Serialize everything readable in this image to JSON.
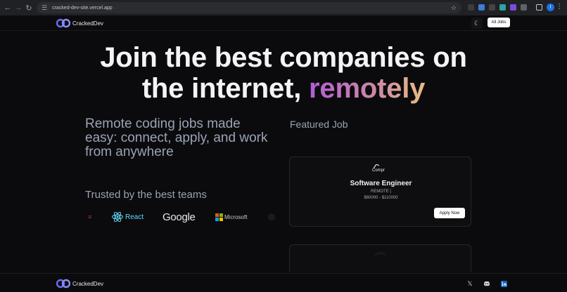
{
  "browser": {
    "url": "cracked-dev-site.vercel.app",
    "profile_initial": "I"
  },
  "header": {
    "brand": "CrackedDev",
    "all_jobs_label": "All Jobs"
  },
  "hero": {
    "line1": "Join the best companies on",
    "line2_prefix": "the internet, ",
    "line2_highlight": "remotely"
  },
  "tagline": "Remote coding jobs made easy: connect, apply, and work from anywhere",
  "trusted": {
    "heading": "Trusted by the best teams",
    "brands": [
      "React",
      "Google",
      "Microsoft"
    ]
  },
  "featured": {
    "heading": "Featured Job",
    "company_logo_text": "Compr",
    "title": "Software Engineer",
    "location": "REMOTE |",
    "salary": "$60000 - $110000",
    "apply_label": "Apply Now"
  },
  "footer": {
    "brand": "CrackedDev"
  },
  "colors": {
    "background": "#0b0b0d",
    "gradient": [
      "#b05ed6",
      "#cc86a8",
      "#e8bc83"
    ],
    "muted_text": "#9aa3b5",
    "react": "#61dafb"
  }
}
